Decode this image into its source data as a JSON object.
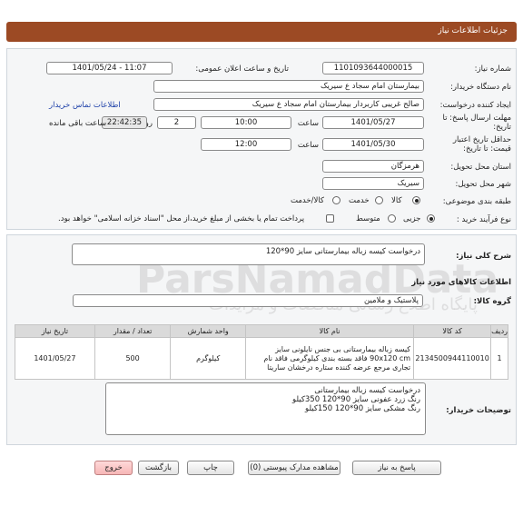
{
  "header": {
    "title": "جزئیات اطلاعات نیاز"
  },
  "form": {
    "need_number_label": "شماره نیاز:",
    "need_number": "1101093644000015",
    "announce_label": "تاریخ و ساعت اعلان عمومی:",
    "announce_value": "1401/05/24 - 11:07",
    "buyer_org_label": "نام دستگاه خریدار:",
    "buyer_org": "بیمارستان امام سجاد  ع  سیریک",
    "creator_label": "ایجاد کننده درخواست:",
    "creator": "صالح غریبی کاربردار بیمارستان امام سجاد  ع  سیریک",
    "contact_link": "اطلاعات تماس خریدار",
    "deadline_label_1": "مهلت ارسال پاسخ: تا",
    "deadline_label_2": "تاریخ:",
    "deadline_date": "1401/05/27",
    "time_label": "ساعت",
    "deadline_time": "10:00",
    "days_value": "2",
    "days_label": "روز و",
    "remaining_time": "22:42:35",
    "remaining_label": "ساعت باقی مانده",
    "validity_label_1": "حداقل تاریخ اعتبار",
    "validity_label_2": "قیمت: تا تاریخ:",
    "validity_date": "1401/05/30",
    "validity_time_label": "ساعت",
    "validity_time": "12:00",
    "province_label": "استان محل تحویل:",
    "province": "هرمزگان",
    "city_label": "شهر محل تحویل:",
    "city": "سیریک",
    "category_label": "طبقه بندی موضوعی:",
    "category_options": [
      "کالا",
      "خدمت",
      "کالا/خدمت"
    ],
    "purchase_label": "نوع فرآیند خرید :",
    "purchase_options": [
      "جزیی",
      "متوسط"
    ],
    "payment_note": "پرداخت تمام یا بخشی از مبلغ خرید،از محل \"اسناد خزانه اسلامی\" خواهد بود."
  },
  "needs": {
    "summary_label": "شرح کلی نیاز:",
    "summary": "درخواست کیسه زباله بیمارستانی سایز 90*120",
    "goods_title": "اطلاعات کالاهای مورد نیاز",
    "group_label": "گروه کالا:",
    "group": "پلاستیک و ملامین"
  },
  "table": {
    "headers": [
      "ردیف",
      "کد کالا",
      "نام کالا",
      "واحد شمارش",
      "تعداد / مقدار",
      "تاریخ نیاز"
    ],
    "rows": [
      {
        "row": "1",
        "code": "2134500944110010",
        "name": "کیسه زباله بیمارستانی بی جنس نایلونی سایز 90x120 cm فاقد بسته بندی کیلوگرمی فاقد نام تجاری مرجع عرضه کننده ستاره درخشان ساریتا",
        "unit": "کیلوگرم",
        "qty": "500",
        "date": "1401/05/27"
      }
    ]
  },
  "buyer_notes": {
    "label": "توضیحات خریدار:",
    "lines": [
      "درخواست کیسه زباله بیمارستانی",
      "رنگ زرد عفونی سایز 90*120  350کیلو",
      "رنگ مشکی سایز 90*120    150کیلو"
    ]
  },
  "buttons": {
    "reply": "پاسخ به نیاز",
    "attachments": "مشاهده مدارک پیوستی (0)",
    "print": "چاپ",
    "back": "بازگشت",
    "exit": "خروج"
  },
  "watermark": {
    "brand": "ParsNamadData",
    "subtitle": "پایگاه اطلاع رسانی مناقصات و مزایدات"
  },
  "colors": {
    "header": "#9c4a24",
    "link": "#1c3fa8",
    "exit_button": "#f6b6b6"
  }
}
